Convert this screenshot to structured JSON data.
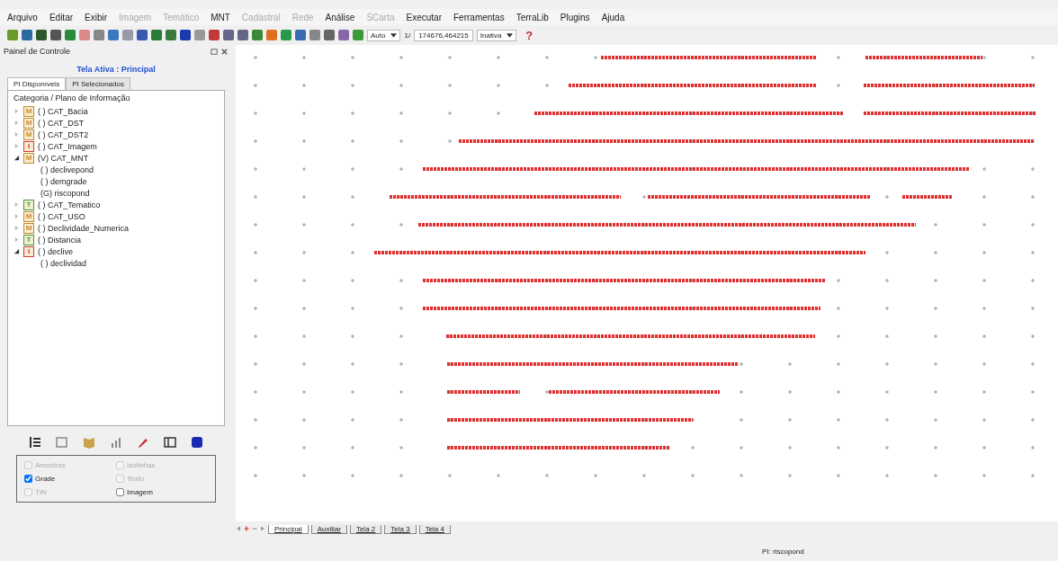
{
  "menu": [
    {
      "label": "Arquivo",
      "disabled": false
    },
    {
      "label": "Editar",
      "disabled": false
    },
    {
      "label": "Exibir",
      "disabled": false
    },
    {
      "label": "Imagem",
      "disabled": true
    },
    {
      "label": "Temático",
      "disabled": true
    },
    {
      "label": "MNT",
      "disabled": false
    },
    {
      "label": "Cadastral",
      "disabled": true
    },
    {
      "label": "Rede",
      "disabled": true
    },
    {
      "label": "Análise",
      "disabled": false
    },
    {
      "label": "SCarta",
      "disabled": true
    },
    {
      "label": "Executar",
      "disabled": false
    },
    {
      "label": "Ferramentas",
      "disabled": false
    },
    {
      "label": "TerraLib",
      "disabled": false
    },
    {
      "label": "Plugins",
      "disabled": false
    },
    {
      "label": "Ajuda",
      "disabled": false
    }
  ],
  "toolbar": {
    "zoom_mode": "Auto",
    "scale_prefix": "1/",
    "scale": "174676,464215",
    "state": "Inativa",
    "help": "?"
  },
  "panel": {
    "title": "Painel de Controle",
    "active_screen": "Tela Ativa : Principal",
    "tabs": [
      {
        "label": "PI Disponíveis",
        "selected": true
      },
      {
        "label": "PI Selecionados",
        "selected": false
      }
    ],
    "tree_header": "Categoria / Plano de Informação",
    "tree": [
      {
        "type": "M",
        "label": "( ) CAT_Bacia",
        "expanded": false
      },
      {
        "type": "M",
        "label": "( ) CAT_DST",
        "expanded": false
      },
      {
        "type": "M",
        "label": "( ) CAT_DST2",
        "expanded": false
      },
      {
        "type": "I",
        "label": "( ) CAT_Imagem",
        "expanded": false
      },
      {
        "type": "M",
        "label": "(V) CAT_MNT",
        "expanded": true,
        "children": [
          {
            "label": "( ) declivepond"
          },
          {
            "label": "( ) demgrade"
          },
          {
            "label": "(G) riscopond"
          }
        ]
      },
      {
        "type": "T",
        "label": "( ) CAT_Tematico",
        "expanded": false
      },
      {
        "type": "M",
        "label": "( ) CAT_USO",
        "expanded": false
      },
      {
        "type": "M",
        "label": "( ) Declividade_Numerica",
        "expanded": false
      },
      {
        "type": "T",
        "label": "( ) Distancia",
        "expanded": false
      },
      {
        "type": "I",
        "label": "( ) declive",
        "expanded": true,
        "children": [
          {
            "label": "( ) declividad"
          }
        ]
      }
    ],
    "options": [
      {
        "label": "Amostras",
        "checked": false,
        "disabled": true
      },
      {
        "label": "Isolinhas",
        "checked": false,
        "disabled": true
      },
      {
        "label": "Grade",
        "checked": true,
        "disabled": false
      },
      {
        "label": "Texto",
        "checked": false,
        "disabled": true
      },
      {
        "label": "TIN",
        "checked": false,
        "disabled": true
      },
      {
        "label": "Imagem",
        "checked": false,
        "disabled": false
      }
    ]
  },
  "screen_tabs": [
    {
      "label": "Principal",
      "selected": true
    },
    {
      "label": "Auxiliar",
      "selected": false
    },
    {
      "label": "Tela 2",
      "selected": false
    },
    {
      "label": "Tela 3",
      "selected": false
    },
    {
      "label": "Tela 4",
      "selected": false
    }
  ],
  "status_bar": "PI: riscopond"
}
